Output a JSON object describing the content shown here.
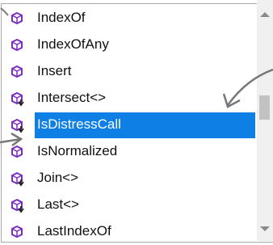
{
  "completion_list": {
    "items": [
      {
        "label": "IndexOf",
        "icon": "method-icon",
        "selected": false
      },
      {
        "label": "IndexOfAny",
        "icon": "method-icon",
        "selected": false
      },
      {
        "label": "Insert",
        "icon": "method-icon",
        "selected": false
      },
      {
        "label": "Intersect<>",
        "icon": "extension-method-icon",
        "selected": false
      },
      {
        "label": "IsDistressCall",
        "icon": "extension-method-icon",
        "selected": true
      },
      {
        "label": "IsNormalized",
        "icon": "method-icon",
        "selected": false
      },
      {
        "label": "Join<>",
        "icon": "extension-method-icon",
        "selected": false
      },
      {
        "label": "Last<>",
        "icon": "extension-method-icon",
        "selected": false
      },
      {
        "label": "LastIndexOf",
        "icon": "method-icon",
        "selected": false
      }
    ],
    "selection_color": "#0e7fe4",
    "method_icon_color": "#7b2fbe"
  },
  "scrollbar": {
    "up_icon": "triangle-up-icon",
    "down_icon": "triangle-down-icon"
  }
}
